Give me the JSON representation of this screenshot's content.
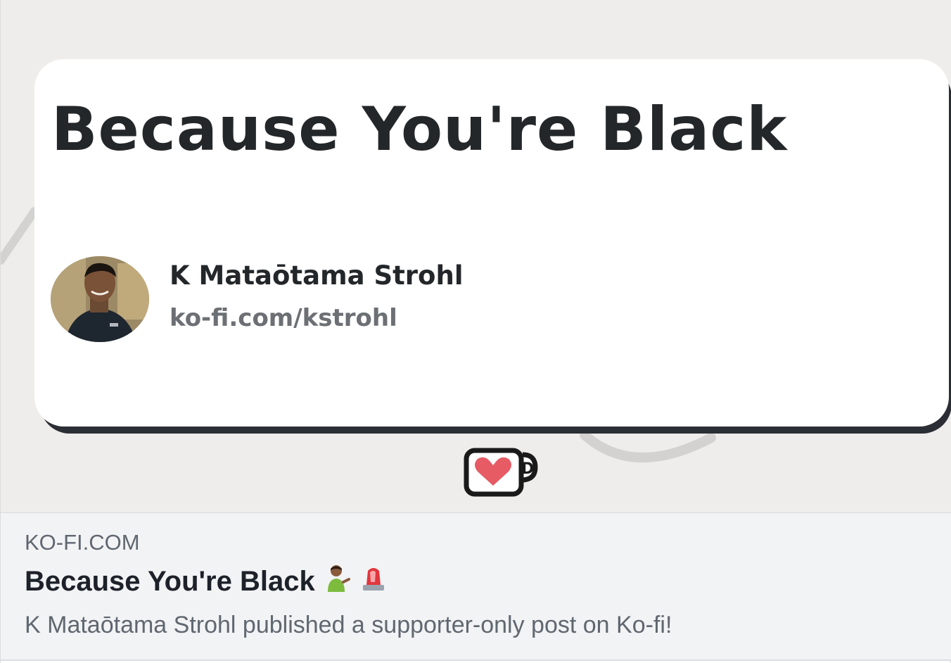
{
  "preview_image": {
    "card_title": "Because You're Black",
    "author_name": "K Mataōtama Strohl",
    "author_url": "ko-fi.com/kstrohl",
    "avatar_icon": "profile-photo",
    "logo_icon": "kofi-cup-heart-icon"
  },
  "meta": {
    "domain": "KO-FI.COM",
    "title": "Because You're Black",
    "title_emojis": [
      "man-tipping-hand-emoji",
      "police-light-emoji"
    ],
    "description": "K Mataōtama Strohl published a supporter-only post on Ko-fi!"
  },
  "colors": {
    "image_background": "#efedec",
    "card_background": "#ffffff",
    "card_shadow": "#2c2e35",
    "title_text": "#24272a",
    "meta_background": "#f2f3f5",
    "meta_secondary_text": "#606770",
    "heart": "#e65b64"
  }
}
